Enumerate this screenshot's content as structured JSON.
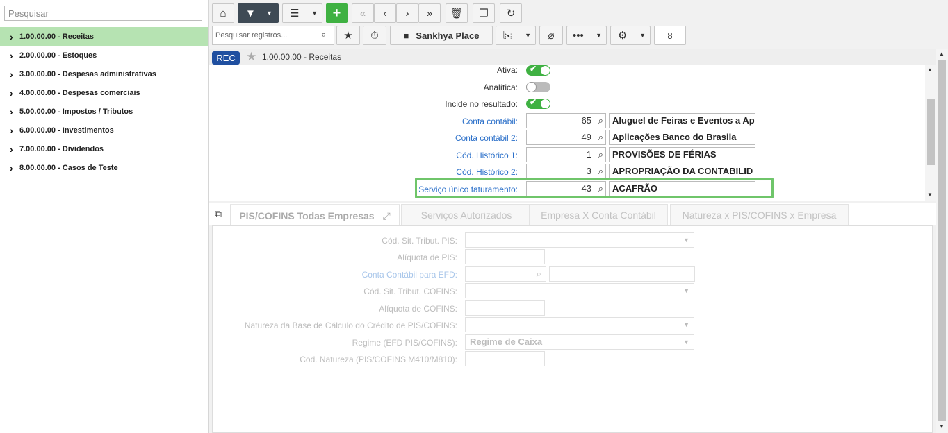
{
  "sidebar": {
    "search_placeholder": "Pesquisar",
    "items": [
      {
        "label": "1.00.00.00 - Receitas"
      },
      {
        "label": "2.00.00.00 - Estoques"
      },
      {
        "label": "3.00.00.00 - Despesas administrativas"
      },
      {
        "label": "4.00.00.00 - Despesas comerciais"
      },
      {
        "label": "5.00.00.00 - Impostos / Tributos"
      },
      {
        "label": "6.00.00.00 - Investimentos"
      },
      {
        "label": "7.00.00.00 - Dividendos"
      },
      {
        "label": "8.00.00.00 - Casos de Teste"
      }
    ]
  },
  "toolbar": {
    "search_placeholder": "Pesquisar registros...",
    "place_label": "Sankhya Place",
    "count": "8"
  },
  "breadcrumb": {
    "badge": "REC",
    "title": "1.00.00.00 - Receitas"
  },
  "form": {
    "ativa_label": "Ativa:",
    "analitica_label": "Analítica:",
    "incide_label": "Incide no resultado:",
    "toggles": {
      "ativa": true,
      "analitica": false,
      "incide": true
    },
    "rows": [
      {
        "label": "Conta contábil:",
        "code": "65",
        "desc": "Aluguel de Feiras e Eventos a Ap"
      },
      {
        "label": "Conta contábil 2:",
        "code": "49",
        "desc": "Aplicações Banco do Brasila"
      },
      {
        "label": "Cód. Histórico 1:",
        "code": "1",
        "desc": "PROVISÕES DE FÉRIAS"
      },
      {
        "label": "Cód. Histórico 2:",
        "code": "3",
        "desc": "APROPRIAÇÃO DA CONTABILID"
      },
      {
        "label": "Serviço único faturamento:",
        "code": "43",
        "desc": "ACAFRÃO"
      }
    ]
  },
  "tabs": [
    {
      "label": "PIS/COFINS Todas Empresas"
    },
    {
      "label": "Serviços Autorizados"
    },
    {
      "label": "Empresa X Conta Contábil"
    },
    {
      "label": "Natureza x PIS/COFINS x Empresa"
    }
  ],
  "panel": {
    "fields": [
      {
        "label": "Cód. Sit. Tribut. PIS:",
        "value": ""
      },
      {
        "label": "Alíquota de PIS:",
        "value": ""
      },
      {
        "label": "Conta Contábil para EFD:",
        "value": ""
      },
      {
        "label": "Cód. Sit. Tribut. COFINS:",
        "value": ""
      },
      {
        "label": "Alíquota de COFINS:",
        "value": ""
      },
      {
        "label": "Natureza da Base de Cálculo do Crédito de PIS/COFINS:",
        "value": ""
      },
      {
        "label": "Regime (EFD PIS/COFINS):",
        "value": "Regime de Caixa"
      },
      {
        "label": "Cod. Natureza (PIS/COFINS M410/M810):",
        "value": ""
      }
    ]
  },
  "colors": {
    "accent_green": "#3fb142",
    "badge_blue": "#1f4fa0",
    "link_blue": "#2a6fc9",
    "selection_green": "#b6e3b2",
    "highlight_border": "#6fc56a"
  }
}
